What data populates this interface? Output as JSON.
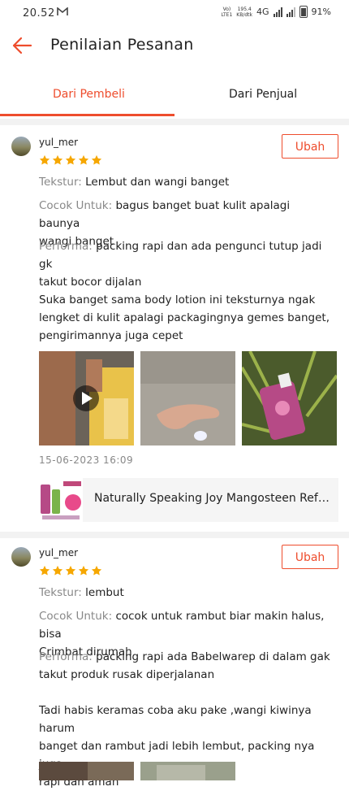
{
  "status_bar": {
    "time": "20.52",
    "notification_icon": "gmail-icon",
    "volte": "Vo)\nLTE1",
    "speed_value": "195.4",
    "speed_unit": "KB/dtk",
    "network": "4G",
    "battery": "91%"
  },
  "header": {
    "title": "Penilaian Pesanan",
    "back_icon": "arrow-left-icon"
  },
  "tabs": [
    {
      "label": "Dari Pembeli",
      "active": true
    },
    {
      "label": "Dari Penjual",
      "active": false
    }
  ],
  "accent_color": "#ee4d2d",
  "reviews": [
    {
      "username": "yul_mer",
      "rating": 5,
      "edit_label": "Ubah",
      "texture_label": "Tekstur",
      "texture": "Lembut dan wangi banget",
      "suitable_label": "Cocok Untuk",
      "suitable_line1": "bagus banget buat kulit apalagi baunya",
      "suitable_line2": "wangi banget",
      "performance_label": "Performa",
      "performance_line1": "packing rapi dan ada pengunci tutup jadi gk",
      "performance_line2": "takut bocor dijalan",
      "comment_line1": "Suka banget sama body lotion ini teksturnya ngak",
      "comment_line2": "lengket di kulit apalagi packagingnya gemes banget,",
      "comment_line3": "pengirimannya juga cepet",
      "media": [
        "video-thumbnail",
        "photo-hand",
        "photo-bottle"
      ],
      "date": "15-06-2023 16:09",
      "product": {
        "name": "Naturally Speaking Joy Mangosteen Refreshing Body Lotion"
      }
    },
    {
      "username": "yul_mer",
      "rating": 5,
      "edit_label": "Ubah",
      "texture_label": "Tekstur",
      "texture": "lembut",
      "suitable_label": "Cocok Untuk",
      "suitable_line1": "cocok untuk rambut biar makin halus, bisa",
      "suitable_line2": "Crimbat dirumah",
      "performance_label": "Performa",
      "performance_line1": "packing rapi ada Babelwarep di dalam gak",
      "performance_line2": "takut produk rusak diperjalanan",
      "comment_line1": "Tadi habis keramas coba aku pake ,wangi kiwinya harum",
      "comment_line2": "banget dan rambut jadi lebih lembut, packing nya juga",
      "comment_line3": "rapi dan aman"
    }
  ]
}
